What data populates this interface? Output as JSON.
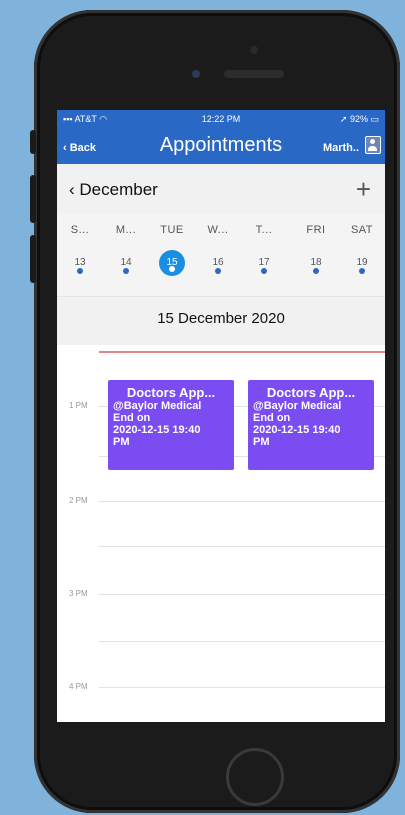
{
  "status": {
    "carrier": "AT&T",
    "time": "12:22 PM",
    "battery": "92%"
  },
  "nav": {
    "back": "Back",
    "title": "Appointments",
    "user": "Marth.."
  },
  "month": {
    "label": "December",
    "add": "+"
  },
  "week": [
    {
      "name": "S...",
      "date": "13"
    },
    {
      "name": "M...",
      "date": "14"
    },
    {
      "name": "TUE",
      "date": "15"
    },
    {
      "name": "W...",
      "date": "16"
    },
    {
      "name": "T...",
      "date": "17"
    },
    {
      "name": "FRI",
      "date": "18"
    },
    {
      "name": "SAT",
      "date": "19"
    }
  ],
  "selected_date": "15 December 2020",
  "hours": [
    "1 PM",
    "2 PM",
    "3 PM",
    "4 PM"
  ],
  "events": [
    {
      "title": "Doctors App...",
      "location": "@Baylor Medical",
      "end_label": "End on",
      "end_time": "2020-12-15 19:40",
      "end_ampm": "PM"
    },
    {
      "title": "Doctors App...",
      "location": "@Baylor Medical",
      "end_label": "End on",
      "end_time": "2020-12-15 19:40",
      "end_ampm": "PM"
    }
  ],
  "colors": {
    "header": "#2a68c6",
    "event": "#7b4cf2",
    "selected_day": "#1a8fe2",
    "background": "#7fb3dc"
  }
}
